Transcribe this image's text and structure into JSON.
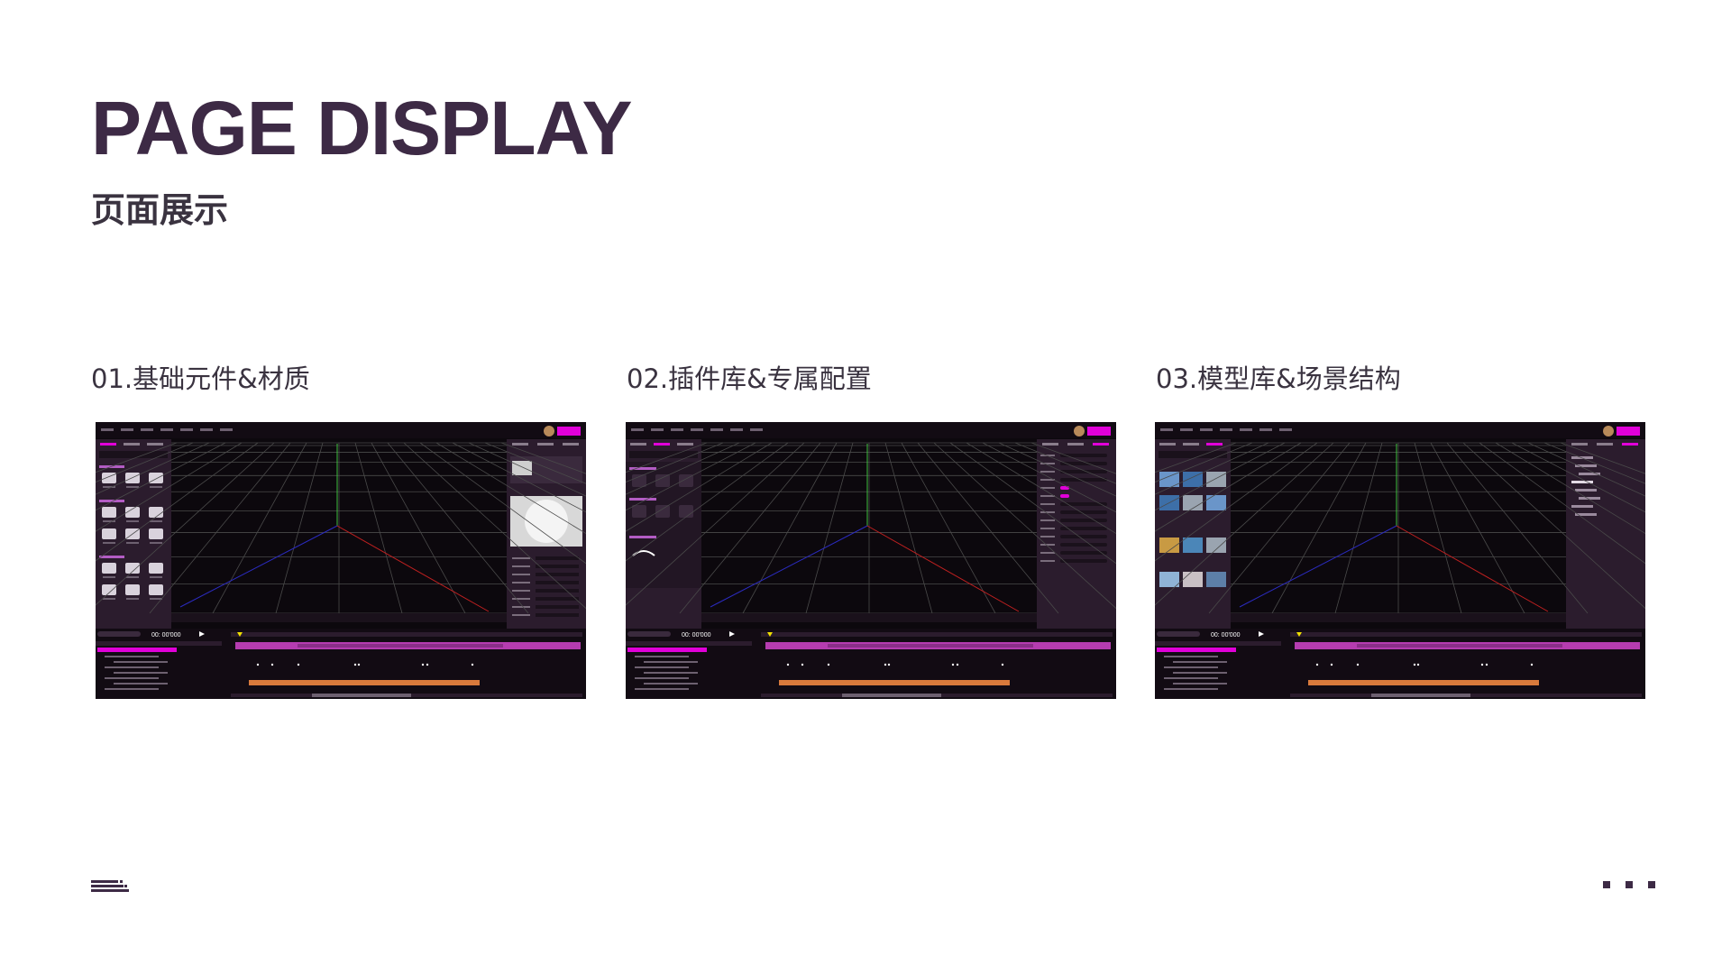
{
  "page": {
    "title": "PAGE DISPLAY",
    "subtitle": "页面展示"
  },
  "colors": {
    "title": "#3d2a45",
    "text": "#3a3340",
    "accent": "#e100d9",
    "panel": "#2b1c2d",
    "viewport": "#0c080d",
    "timeline_bar": "#d97a3c"
  },
  "sections": [
    {
      "caption": "01.基础元件&材质",
      "variant": "materials",
      "timecode": "00: 00'000"
    },
    {
      "caption": "02.插件库&专属配置",
      "variant": "plugins",
      "timecode": "00: 00'000"
    },
    {
      "caption": "03.模型库&场景结构",
      "variant": "models",
      "timecode": "00: 00'000"
    }
  ],
  "icons": {
    "footer_left": "menu-lines-icon",
    "footer_right": "more-dots-icon"
  }
}
